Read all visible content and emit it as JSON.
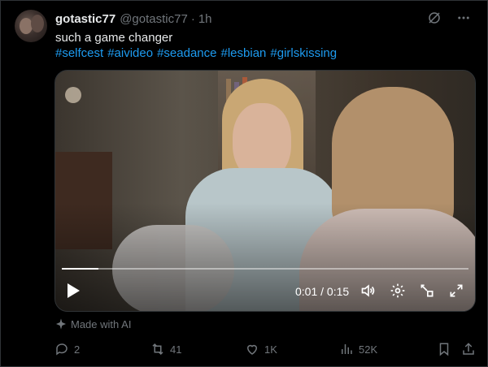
{
  "post": {
    "display_name": "gotastic77",
    "handle": "@gotastic77",
    "separator": "·",
    "time": "1h",
    "text": "such a game changer",
    "hashtags": [
      "#selfcest",
      "#aivideo",
      "#seadance",
      "#lesbian",
      "#girlskissing"
    ],
    "made_with_ai": "Made with AI"
  },
  "video": {
    "time_readout": "0:01 / 0:15",
    "progress_fraction": 0.09
  },
  "actions": {
    "replies": "2",
    "reposts": "41",
    "likes": "1K",
    "views": "52K"
  },
  "colors": {
    "background": "#000000",
    "text": "#e7e9ea",
    "muted": "#71767b",
    "link": "#1d9bf0"
  },
  "icons": [
    "grok-icon",
    "more-icon",
    "play-icon",
    "volume-icon",
    "settings-icon",
    "pop-out-icon",
    "fullscreen-icon",
    "sparkle-icon",
    "reply-icon",
    "repost-icon",
    "like-icon",
    "views-icon",
    "bookmark-icon",
    "share-icon"
  ]
}
